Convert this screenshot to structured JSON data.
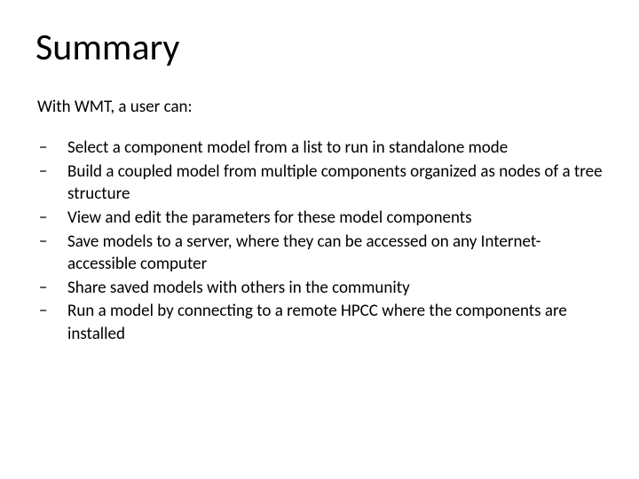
{
  "title": "Summary",
  "intro": "With WMT, a user can:",
  "bullets": [
    "Select a component model from a list to run in standalone mode",
    "Build a coupled model from multiple components organized as nodes of a tree structure",
    "View and edit the parameters for these model components",
    "Save models to a server, where they can be accessed on any Internet-accessible computer",
    "Share saved models with others in the community",
    "Run a model by connecting to a remote HPCC where the components are installed"
  ]
}
